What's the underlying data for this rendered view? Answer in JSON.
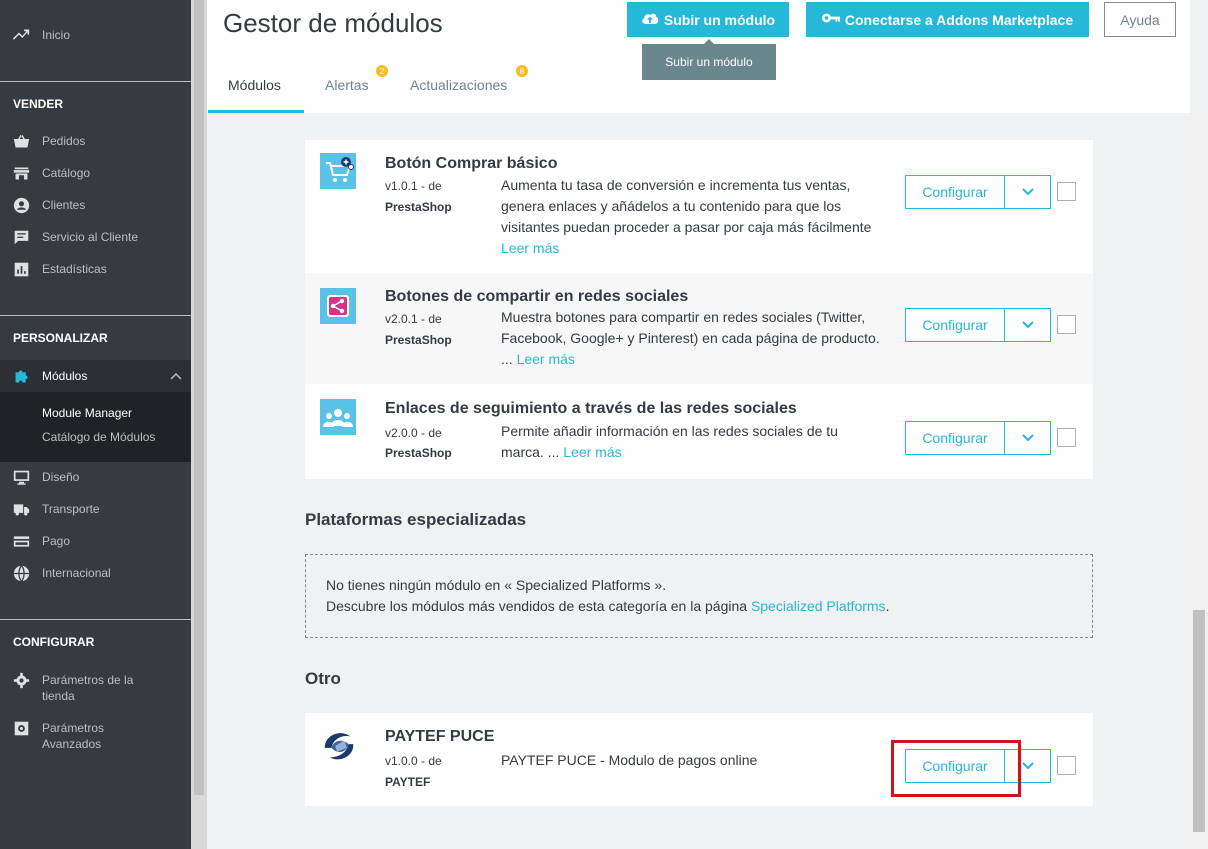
{
  "sidebar": {
    "top_item": "Inicio",
    "sections": {
      "vender": "VENDER",
      "personalizar": "PERSONALIZAR",
      "configurar": "CONFIGURAR"
    },
    "vender_items": [
      "Pedidos",
      "Catálogo",
      "Clientes",
      "Servicio al Cliente",
      "Estadísticas"
    ],
    "modulos": "Módulos",
    "modulos_sub": [
      "Module Manager",
      "Catálogo de Módulos"
    ],
    "personalizar_items": [
      "Diseño",
      "Transporte",
      "Pago",
      "Internacional"
    ],
    "configurar_items": [
      {
        "line1": "Parámetros de la",
        "line2": "tienda"
      },
      {
        "line1": "Parámetros",
        "line2": "Avanzados"
      }
    ]
  },
  "header": {
    "title": "Gestor de módulos",
    "upload_button": "Subir un módulo",
    "addons_button": "Conectarse a Addons Marketplace",
    "help_button": "Ayuda",
    "tooltip": "Subir un módulo",
    "tabs": [
      {
        "label": "Módulos"
      },
      {
        "label": "Alertas",
        "badge": "2"
      },
      {
        "label": "Actualizaciones",
        "badge": "8"
      }
    ]
  },
  "modules": [
    {
      "name": "Botón Comprar básico",
      "version": "v1.0.1 - de",
      "author": "PrestaShop",
      "description": "Aumenta tu tasa de conversión e incrementa tus ventas, genera enlaces y añádelos a tu contenido para que los visitantes puedan proceder a pasar por caja más fácilmente",
      "more": "Leer más",
      "configure": "Configurar"
    },
    {
      "name": "Botones de compartir en redes sociales",
      "version": "v2.0.1 - de",
      "author": "PrestaShop",
      "description": "Muestra botones para compartir en redes sociales (Twitter, Facebook, Google+ y Pinterest) en cada página de producto. ...",
      "more": "Leer más",
      "configure": "Configurar"
    },
    {
      "name": "Enlaces de seguimiento a través de las redes sociales",
      "version": "v2.0.0 - de",
      "author": "PrestaShop",
      "description": "Permite añadir información en las redes sociales de tu marca. ...",
      "more": "Leer más",
      "configure": "Configurar"
    }
  ],
  "specialized": {
    "title": "Plataformas especializadas",
    "line1": "No tienes ningún módulo en « Specialized Platforms ».",
    "line2": "Descubre los módulos más vendidos de esta categoría en la página",
    "link": "Specialized Platforms",
    "period": "."
  },
  "otro": {
    "title": "Otro",
    "module": {
      "name": "PAYTEF PUCE",
      "version": "v1.0.0 - de",
      "author": "PAYTEF",
      "description": "PAYTEF PUCE - Modulo de pagos online",
      "configure": "Configurar"
    }
  },
  "colors": {
    "accent": "#25b9d7",
    "sidebar_bg": "#363a41",
    "highlight": "#d0121c"
  }
}
